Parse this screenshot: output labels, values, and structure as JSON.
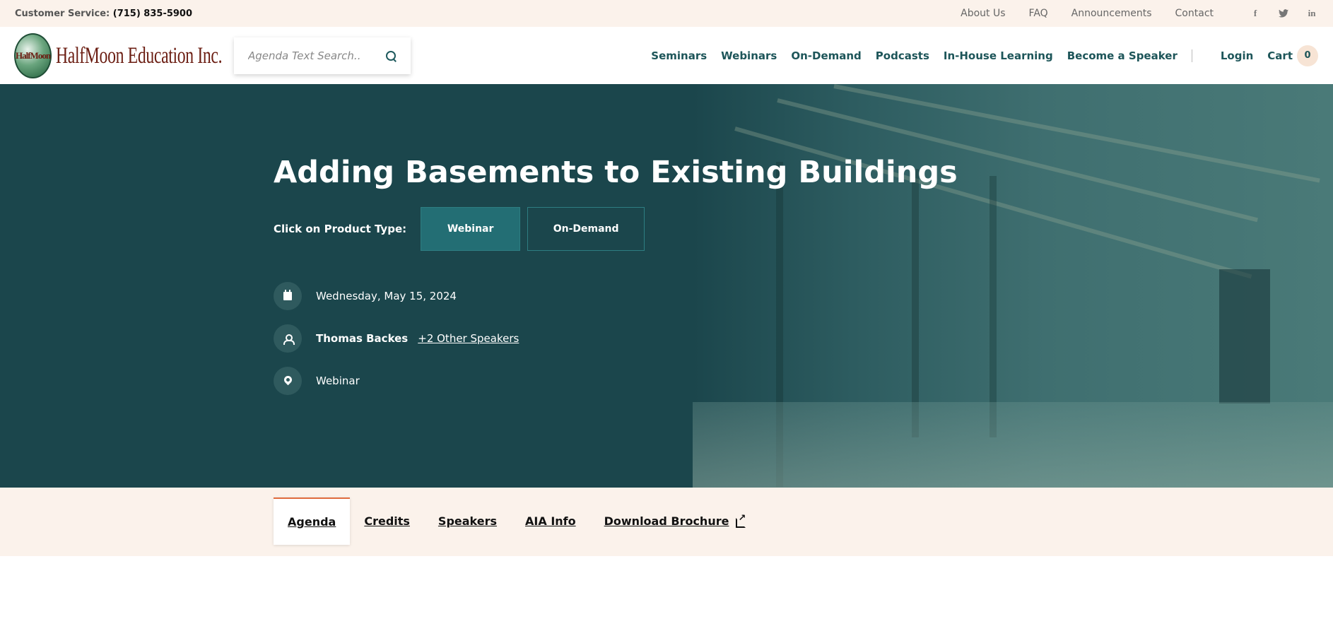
{
  "topbar": {
    "customer_service_label": "Customer Service:",
    "phone": "(715) 835-5900",
    "links": [
      "About Us",
      "FAQ",
      "Announcements",
      "Contact"
    ],
    "social_icons": [
      "facebook-icon",
      "twitter-icon",
      "linkedin-icon"
    ]
  },
  "header": {
    "logo_circle_text": "HalfMoon",
    "logo_text": "HalfMoon Education Inc.",
    "search_placeholder": "Agenda Text Search..",
    "nav": [
      "Seminars",
      "Webinars",
      "On-Demand",
      "Podcasts",
      "In-House Learning",
      "Become a Speaker"
    ],
    "login": "Login",
    "cart_label": "Cart",
    "cart_count": "0"
  },
  "hero": {
    "title": "Adding Basements to Existing Buildings",
    "product_type_label": "Click on Product Type:",
    "product_types": [
      "Webinar",
      "On-Demand"
    ],
    "date": "Wednesday, May 15, 2024",
    "speaker": "Thomas Backes",
    "other_speakers": "+2 Other Speakers",
    "location": "Webinar"
  },
  "tabs": [
    "Agenda",
    "Credits",
    "Speakers",
    "AIA Info",
    "Download Brochure"
  ],
  "colors": {
    "hero_bg": "#1b464c",
    "accent_teal": "#236e74",
    "nav_text": "#1d5559",
    "tab_accent": "#e06b3d",
    "cream": "#fbf2eb"
  }
}
